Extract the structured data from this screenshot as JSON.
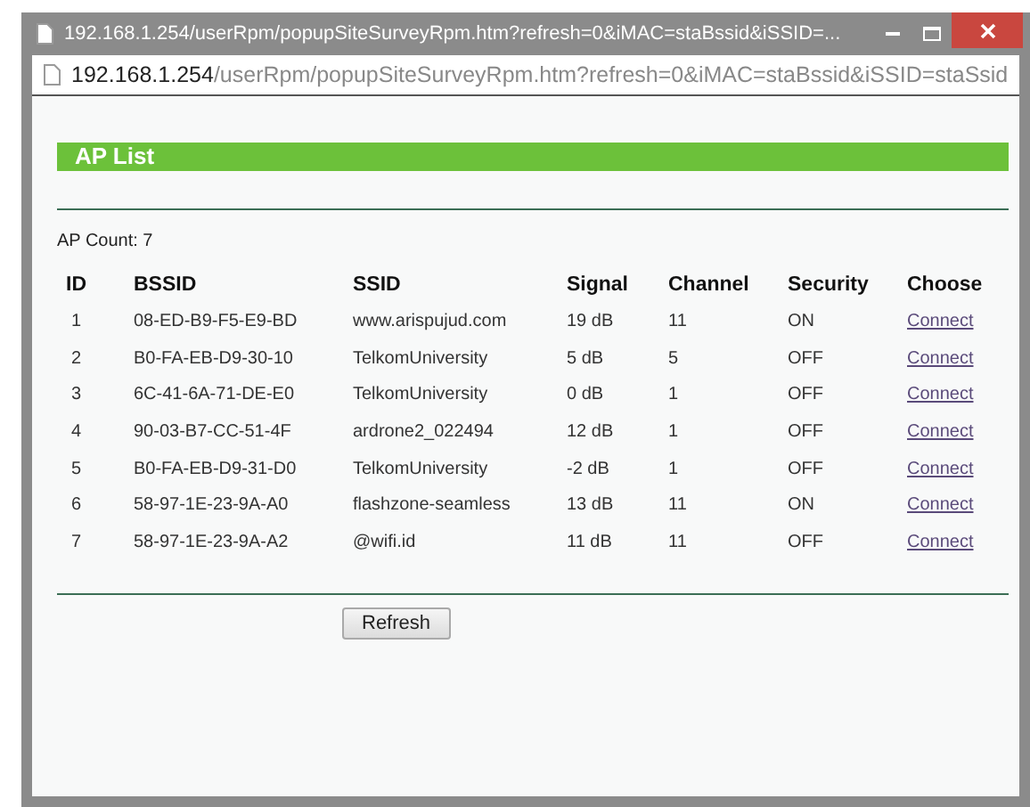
{
  "window": {
    "title": "192.168.1.254/userRpm/popupSiteSurveyRpm.htm?refresh=0&iMAC=staBssid&iSSID=..."
  },
  "address": {
    "host": "192.168.1.254",
    "path": "/userRpm/popupSiteSurveyRpm.htm?refresh=0&iMAC=staBssid&iSSID=staSsid"
  },
  "heading": "AP List",
  "ap_count": "AP Count: 7",
  "table": {
    "columns": [
      "ID",
      "BSSID",
      "SSID",
      "Signal",
      "Channel",
      "Security",
      "Choose"
    ],
    "rows": [
      {
        "id": "1",
        "bssid": "08-ED-B9-F5-E9-BD",
        "ssid": "www.arispujud.com",
        "signal": "19 dB",
        "channel": "11",
        "security": "ON",
        "choose": "Connect"
      },
      {
        "id": "2",
        "bssid": "B0-FA-EB-D9-30-10",
        "ssid": "TelkomUniversity",
        "signal": "5 dB",
        "channel": "5",
        "security": "OFF",
        "choose": "Connect"
      },
      {
        "id": "3",
        "bssid": "6C-41-6A-71-DE-E0",
        "ssid": "TelkomUniversity",
        "signal": "0 dB",
        "channel": "1",
        "security": "OFF",
        "choose": "Connect"
      },
      {
        "id": "4",
        "bssid": "90-03-B7-CC-51-4F",
        "ssid": "ardrone2_022494",
        "signal": "12 dB",
        "channel": "1",
        "security": "OFF",
        "choose": "Connect"
      },
      {
        "id": "5",
        "bssid": "B0-FA-EB-D9-31-D0",
        "ssid": "TelkomUniversity",
        "signal": "-2 dB",
        "channel": "1",
        "security": "OFF",
        "choose": "Connect"
      },
      {
        "id": "6",
        "bssid": "58-97-1E-23-9A-A0",
        "ssid": "flashzone-seamless",
        "signal": "13 dB",
        "channel": "11",
        "security": "ON",
        "choose": "Connect"
      },
      {
        "id": "7",
        "bssid": "58-97-1E-23-9A-A2",
        "ssid": "@wifi.id",
        "signal": "11 dB",
        "channel": "11",
        "security": "OFF",
        "choose": "Connect"
      }
    ]
  },
  "buttons": [
    "Refresh"
  ]
}
